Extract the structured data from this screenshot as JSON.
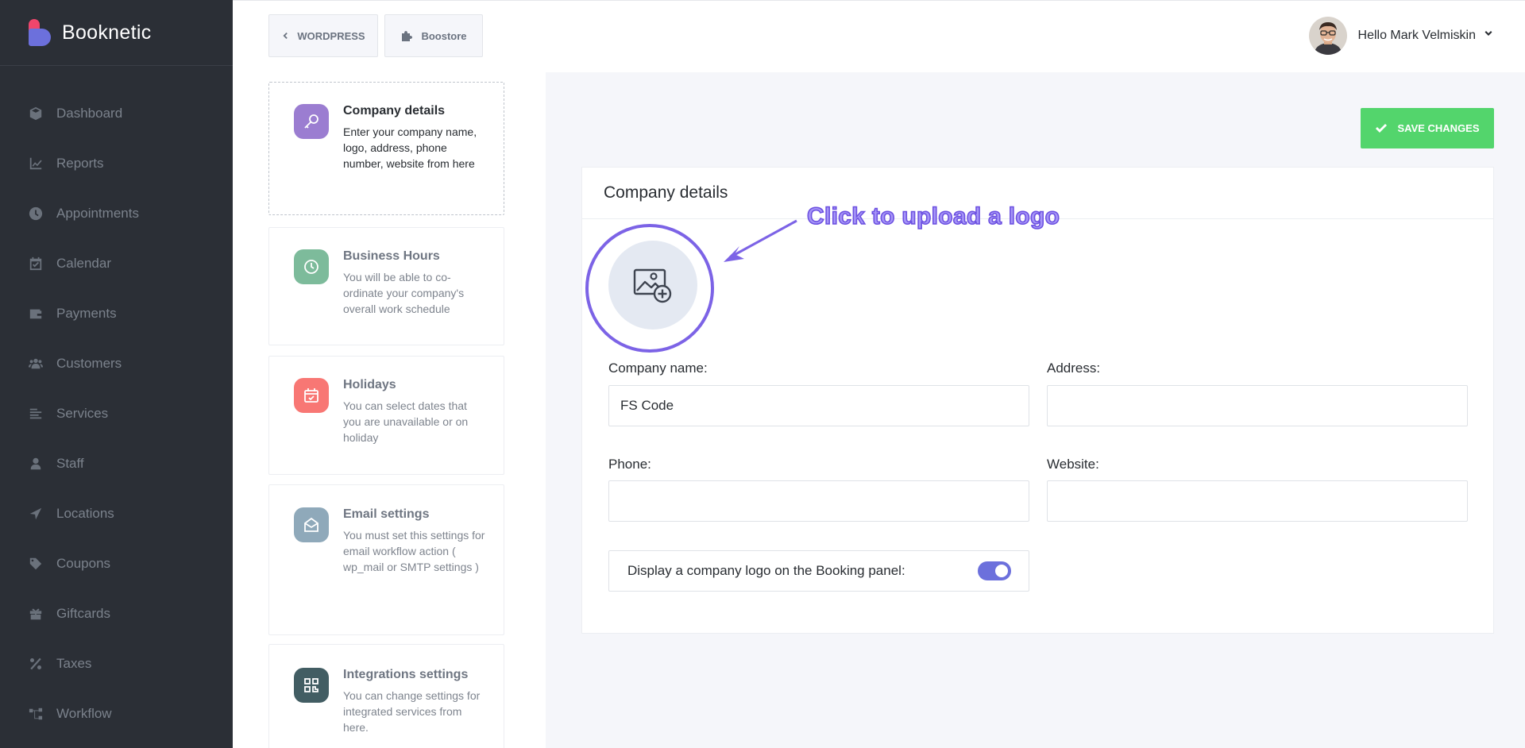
{
  "brand": {
    "name": "Booknetic"
  },
  "sidebar": {
    "items": [
      {
        "label": "Dashboard",
        "icon": "cube-icon"
      },
      {
        "label": "Reports",
        "icon": "chart-line-icon"
      },
      {
        "label": "Appointments",
        "icon": "clock-icon"
      },
      {
        "label": "Calendar",
        "icon": "calendar-check-icon"
      },
      {
        "label": "Payments",
        "icon": "wallet-icon"
      },
      {
        "label": "Customers",
        "icon": "users-icon"
      },
      {
        "label": "Services",
        "icon": "bars-icon"
      },
      {
        "label": "Staff",
        "icon": "user-icon"
      },
      {
        "label": "Locations",
        "icon": "location-arrow-icon"
      },
      {
        "label": "Coupons",
        "icon": "tag-icon"
      },
      {
        "label": "Giftcards",
        "icon": "gift-icon"
      },
      {
        "label": "Taxes",
        "icon": "percent-icon"
      },
      {
        "label": "Workflow",
        "icon": "workflow-icon"
      }
    ]
  },
  "topbar": {
    "wordpress_label": "WORDPRESS",
    "boostore_label": "Boostore",
    "user_greeting": "Hello Mark Velmiskin"
  },
  "settings_menu": [
    {
      "title": "Company details",
      "desc": "Enter your company name, logo, address, phone number, website from here",
      "color": "#9b7dd1"
    },
    {
      "title": "Business Hours",
      "desc": "You will be able to co-ordinate your company's overall work schedule",
      "color": "#7dbb9b"
    },
    {
      "title": "Holidays",
      "desc": "You can select dates that you are unavailable or on holiday",
      "color": "#f87774"
    },
    {
      "title": "Email settings",
      "desc": "You must set this settings for email workflow action ( wp_mail or SMTP settings )",
      "color": "#8fa9ba"
    },
    {
      "title": "Integrations settings",
      "desc": "You can change settings for integrated services from here.",
      "color": "#425d63"
    }
  ],
  "save_label": "SAVE CHANGES",
  "panel": {
    "title": "Company details",
    "annotation": "Click to upload a logo",
    "company_name_label": "Company name:",
    "company_name_value": "FS Code",
    "address_label": "Address:",
    "address_value": "",
    "phone_label": "Phone:",
    "phone_value": "",
    "website_label": "Website:",
    "website_value": "",
    "display_logo_label": "Display a company logo on the Booking panel:",
    "display_logo_enabled": true
  },
  "colors": {
    "accent": "#6c70dc",
    "save": "#53d56c",
    "annotation": "#7c63e6"
  }
}
